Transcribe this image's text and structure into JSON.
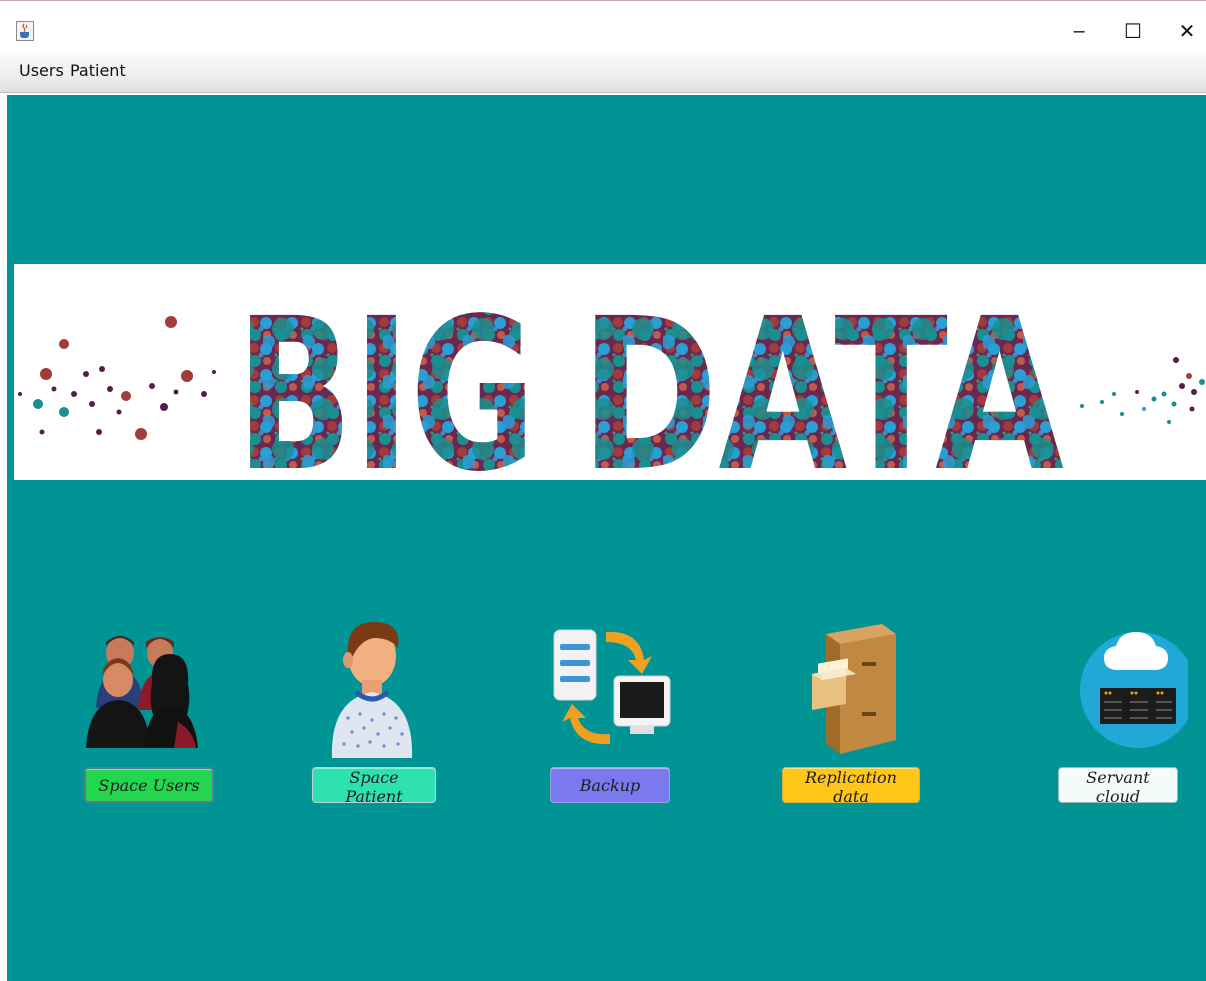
{
  "window": {
    "minimize_glyph": "–",
    "maximize_glyph": "☐",
    "close_glyph": "✕",
    "icon": "java-cup-icon"
  },
  "menu": {
    "items": [
      {
        "label": "Users"
      },
      {
        "label": "Patient"
      }
    ]
  },
  "banner": {
    "text": "BIG DATA",
    "colors": [
      "#5a1a4a",
      "#a23b3b",
      "#1b8f8f",
      "#2a9fd6",
      "#7a2a5a"
    ]
  },
  "features": [
    {
      "label": "Space Users",
      "icon": "users-group-icon",
      "color": "#22d64e"
    },
    {
      "label": "Space  Patient",
      "icon": "patient-icon",
      "color": "#2fe0b0"
    },
    {
      "label": "Backup",
      "icon": "backup-sync-icon",
      "color": "#7a7aee"
    },
    {
      "label": "Replication data",
      "icon": "filing-cabinet-icon",
      "color": "#ffc619"
    },
    {
      "label": "Servant cloud",
      "icon": "cloud-server-icon",
      "color": "#f4fbfb"
    }
  ],
  "colors": {
    "content_background": "#009494",
    "banner_background": "#ffffff"
  }
}
